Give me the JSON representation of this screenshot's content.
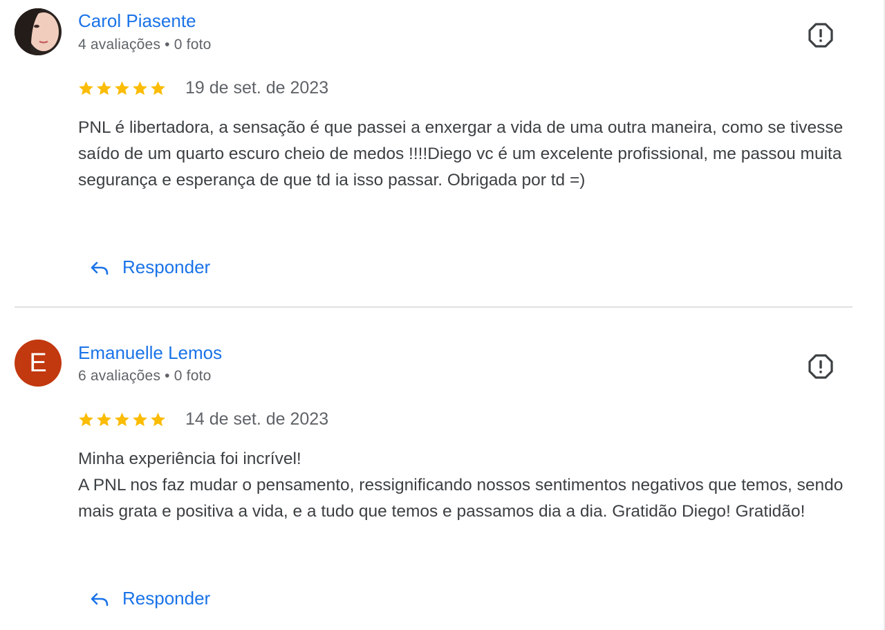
{
  "reviews": [
    {
      "author": "Carol Piasente",
      "meta": "4 avaliações • 0 foto",
      "rating": 5,
      "date": "19 de set. de 2023",
      "text": "PNL é libertadora, a sensação é que passei a enxergar a vida de uma outra maneira, como se tivesse saído de um quarto escuro cheio de medos !!!!Diego vc é um excelente profissional, me passou muita segurança e esperança de que td ia isso passar. Obrigada por td =)",
      "reply_label": "Responder",
      "avatar": "photo"
    },
    {
      "author": "Emanuelle Lemos",
      "meta": "6 avaliações • 0 foto",
      "rating": 5,
      "date": "14 de set. de 2023",
      "text": "Minha experiência foi incrível!\nA PNL nos faz mudar o pensamento, ressignificando nossos sentimentos negativos que temos, sendo mais grata e positiva a vida, e a tudo que temos e passamos dia a dia. Gratidão Diego! Gratidão!",
      "reply_label": "Responder",
      "avatar": "letter",
      "avatar_letter": "E",
      "avatar_color": "#c2380f"
    }
  ],
  "colors": {
    "link": "#1a73e8",
    "star": "#fbbc04",
    "meta": "#5f6368",
    "text": "#3c4043",
    "flag": "#3c4043"
  },
  "icons": {
    "report": "report-flag-icon",
    "reply": "reply-arrow-icon",
    "star": "star-icon"
  }
}
